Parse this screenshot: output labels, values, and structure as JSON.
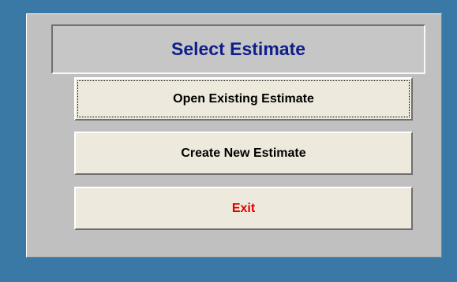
{
  "form": {
    "title": "Select Estimate",
    "buttons": {
      "open_existing": "Open Existing Estimate",
      "create_new": "Create New Estimate",
      "exit": "Exit"
    }
  },
  "colors": {
    "background": "#3a79a6",
    "panel": "#c0c0c0",
    "title_text": "#0e1e8a",
    "button_face": "#ede9dc",
    "exit_text": "#e00000"
  }
}
